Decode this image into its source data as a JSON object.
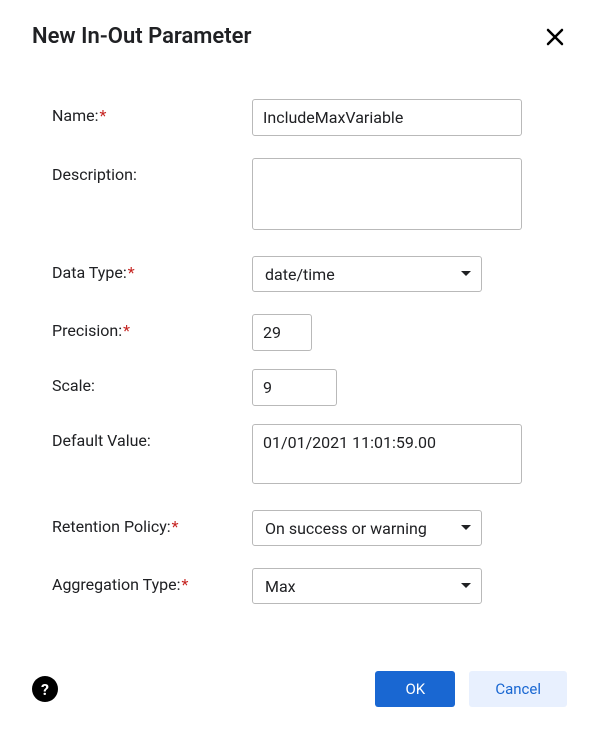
{
  "dialog": {
    "title": "New In-Out Parameter"
  },
  "fields": {
    "name": {
      "label": "Name:",
      "value": "IncludeMaxVariable",
      "required": true
    },
    "description": {
      "label": "Description:",
      "value": "",
      "required": false
    },
    "dataType": {
      "label": "Data Type:",
      "value": "date/time",
      "required": true
    },
    "precision": {
      "label": "Precision:",
      "value": "29",
      "required": true
    },
    "scale": {
      "label": "Scale:",
      "value": "9",
      "required": false
    },
    "defaultValue": {
      "label": "Default Value:",
      "value": "01/01/2021 11:01:59.00",
      "required": false
    },
    "retentionPolicy": {
      "label": "Retention Policy:",
      "value": "On success or warning",
      "required": true
    },
    "aggregationType": {
      "label": "Aggregation Type:",
      "value": "Max",
      "required": true
    }
  },
  "footer": {
    "help": "?",
    "ok": "OK",
    "cancel": "Cancel"
  }
}
